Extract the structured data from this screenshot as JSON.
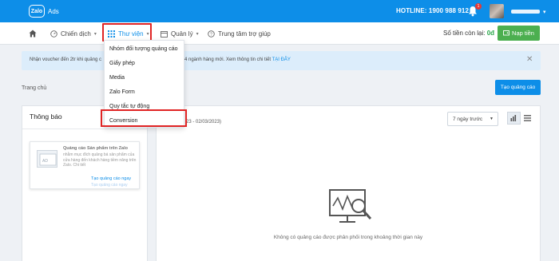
{
  "header": {
    "logo_badge": "Zalo",
    "logo_text": "Ads",
    "hotline": "HOTLINE: 1900 988 912",
    "notification_count": "1",
    "icons": {
      "bell": "bell-icon",
      "caret": "caret-down-icon"
    }
  },
  "nav": {
    "items": [
      {
        "label": "Chiến dịch",
        "icon": "gauge-icon"
      },
      {
        "label": "Thư viện",
        "icon": "grid-icon"
      },
      {
        "label": "Quản lý",
        "icon": "calendar-icon"
      },
      {
        "label": "Trung tâm trợ giúp",
        "icon": "help-circle-icon"
      }
    ],
    "balance_label": "Số tiền còn lại:",
    "balance_value": "0đ",
    "topup_label": "Nạp tiền"
  },
  "notice": {
    "text_left": "Nhận voucher đến 2tr khi quảng c",
    "text_right": "4 ngành hàng mới. Xem thông tin chi tiết",
    "link": "TẠI ĐÂY"
  },
  "breadcrumb": "Trang chủ",
  "create_button": "Tạo quảng cáo",
  "left_panel": {
    "title": "Thông báo",
    "card": {
      "title": "Quảng cáo Sản phẩm trên Zalo",
      "description": "nhằm mục đích quảng bá sản phẩm của cửa hàng đến khách hàng tiềm năng trên Zalo. Chi tiết",
      "link": "Tạo quảng cáo ngay",
      "link_faded": "Tạo quảng cáo ngay"
    }
  },
  "right_panel": {
    "date_range": "23 - 02/03/2023)",
    "range_select": "7 ngày trước",
    "empty_text": "Không có quảng cáo được phân phối trong khoảng thời gian này"
  },
  "dropdown": {
    "items": [
      "Nhóm đối tượng quảng cáo",
      "Giấy phép",
      "Media",
      "Zalo Form",
      "Quy tắc tự động",
      "Conversion"
    ],
    "highlighted": "Conversion"
  },
  "colors": {
    "primary": "#0d8ee8",
    "success": "#4caf50",
    "highlight": "#e02424",
    "notice_bg": "#dcedfb"
  }
}
